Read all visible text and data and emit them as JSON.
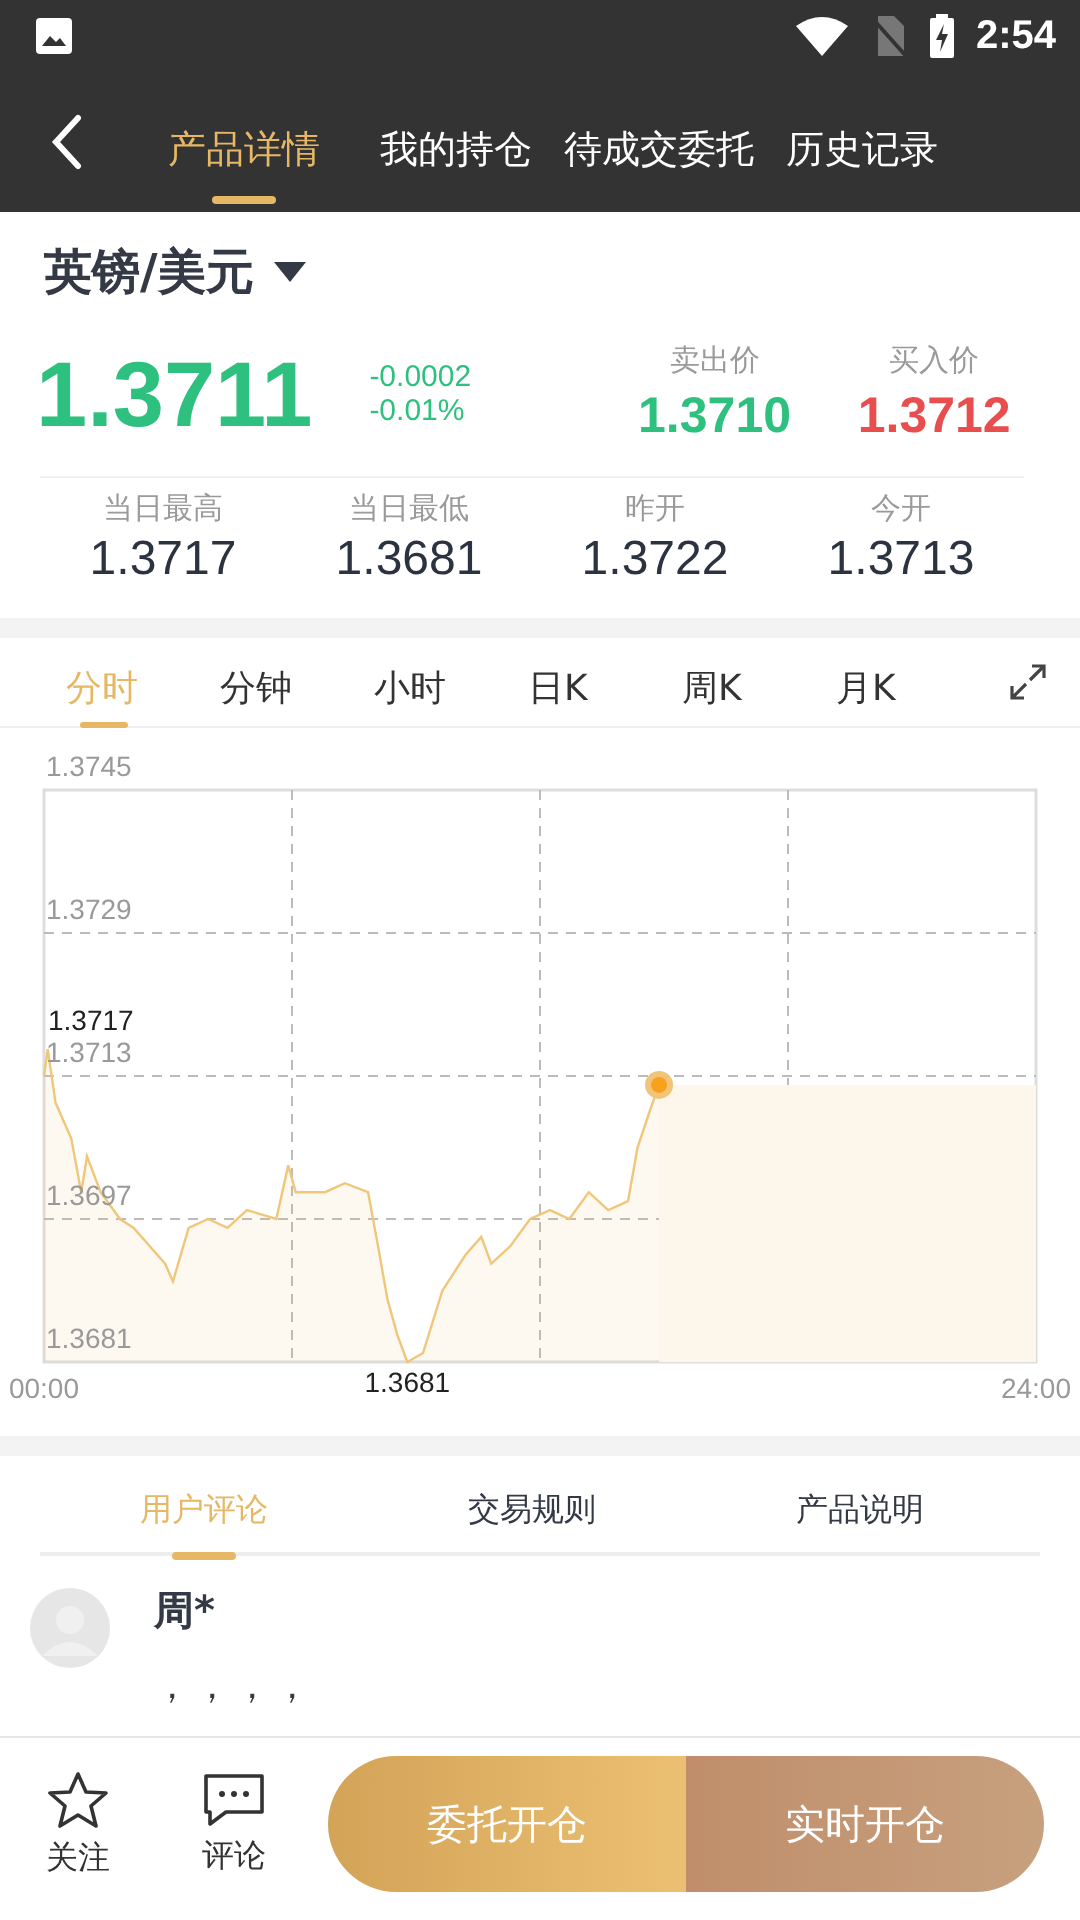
{
  "status_bar": {
    "time": "2:54"
  },
  "nav": {
    "tabs": [
      {
        "label": "产品详情",
        "selected": true
      },
      {
        "label": "我的持仓",
        "selected": false
      },
      {
        "label": "待成交委托",
        "selected": false
      },
      {
        "label": "历史记录",
        "selected": false
      }
    ]
  },
  "product": {
    "name": "英镑/美元",
    "price": "1.3711",
    "change": "-0.0002",
    "change_pct": "-0.01%",
    "sell": {
      "label": "卖出价",
      "value": "1.3710"
    },
    "buy": {
      "label": "买入价",
      "value": "1.3712"
    },
    "stats": [
      {
        "label": "当日最高",
        "value": "1.3717"
      },
      {
        "label": "当日最低",
        "value": "1.3681"
      },
      {
        "label": "昨开",
        "value": "1.3722"
      },
      {
        "label": "今开",
        "value": "1.3713"
      }
    ]
  },
  "periods": [
    {
      "label": "分时",
      "selected": true
    },
    {
      "label": "分钟",
      "selected": false
    },
    {
      "label": "小时",
      "selected": false
    },
    {
      "label": "日K",
      "selected": false
    },
    {
      "label": "周K",
      "selected": false
    },
    {
      "label": "月K",
      "selected": false
    }
  ],
  "chart": {
    "chart_data": {
      "type": "area",
      "grid": true,
      "xlim": [
        0,
        24
      ],
      "ylim": [
        1.3681,
        1.3745
      ],
      "xticks": [
        {
          "value": 0,
          "label": "00:00"
        },
        {
          "value": 24,
          "label": "24:00"
        }
      ],
      "yticks": [
        {
          "value": 1.3745,
          "label": "1.3745"
        },
        {
          "value": 1.3729,
          "label": "1.3729"
        },
        {
          "value": 1.3713,
          "label": "1.3713"
        },
        {
          "value": 1.3697,
          "label": "1.3697"
        },
        {
          "value": 1.3681,
          "label": "1.3681"
        }
      ],
      "x": [
        0,
        0.09,
        0.28,
        0.66,
        0.9,
        1.04,
        1.37,
        1.84,
        2.17,
        2.55,
        2.93,
        3.12,
        3.5,
        3.97,
        4.44,
        4.91,
        5.62,
        5.91,
        6.09,
        6.8,
        7.28,
        7.84,
        8.08,
        8.31,
        8.55,
        8.79,
        9.17,
        9.64,
        10.2,
        10.58,
        10.82,
        11.29,
        11.76,
        12.24,
        12.71,
        13.18,
        13.65,
        14.13,
        14.36,
        14.65,
        14.88
      ],
      "series": [
        {
          "color": "#f0c77a",
          "values": [
            1.3713,
            1.3716,
            1.371,
            1.3706,
            1.37,
            1.3704,
            1.37,
            1.3697,
            1.3696,
            1.3694,
            1.3692,
            1.369,
            1.3696,
            1.3697,
            1.3696,
            1.3698,
            1.3697,
            1.3703,
            1.37,
            1.37,
            1.3701,
            1.37,
            1.3694,
            1.3688,
            1.3684,
            1.3681,
            1.3682,
            1.3689,
            1.3693,
            1.3695,
            1.3692,
            1.3694,
            1.3697,
            1.3698,
            1.3697,
            1.37,
            1.3698,
            1.3699,
            1.3705,
            1.3709,
            1.3712
          ]
        }
      ],
      "annotations": [
        {
          "text": "1.3717",
          "x": 0,
          "y": 1.3717
        },
        {
          "text": "1.3681",
          "x": 8.79,
          "y": 1.3681
        }
      ]
    }
  },
  "comment_tabs": [
    {
      "label": "用户评论",
      "selected": true
    },
    {
      "label": "交易规则",
      "selected": false
    },
    {
      "label": "产品说明",
      "selected": false
    }
  ],
  "comments": [
    {
      "user": "周*",
      "text": "，，，，"
    }
  ],
  "bottom_bar": {
    "follow": "关注",
    "comment": "评论",
    "order_button": "委托开仓",
    "open_button": "实时开仓"
  }
}
